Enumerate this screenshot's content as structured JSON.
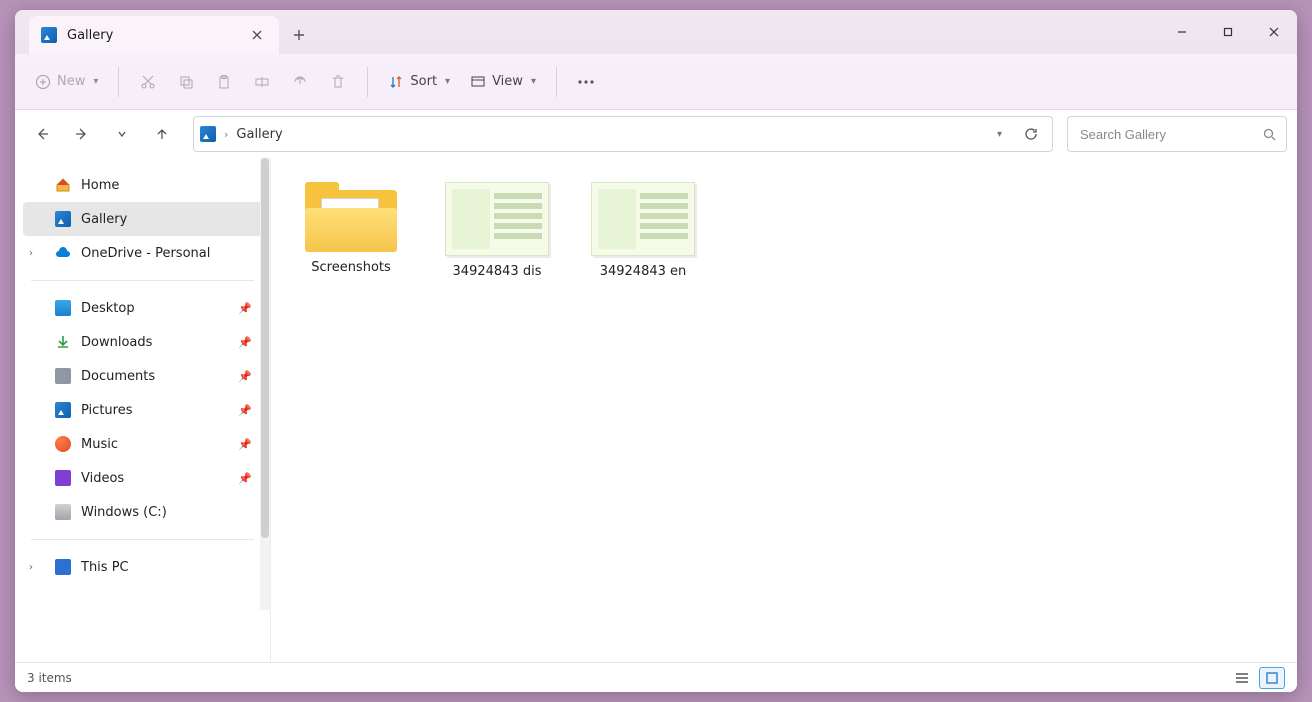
{
  "titlebar": {
    "tab_title": "Gallery"
  },
  "toolbar": {
    "new_label": "New",
    "sort_label": "Sort",
    "view_label": "View"
  },
  "breadcrumb": {
    "current": "Gallery"
  },
  "search": {
    "placeholder": "Search Gallery"
  },
  "sidebar": {
    "home": "Home",
    "gallery": "Gallery",
    "onedrive": "OneDrive - Personal",
    "desktop": "Desktop",
    "downloads": "Downloads",
    "documents": "Documents",
    "pictures": "Pictures",
    "music": "Music",
    "videos": "Videos",
    "drive_c": "Windows (C:)",
    "this_pc": "This PC"
  },
  "items": [
    {
      "type": "folder",
      "label": "Screenshots"
    },
    {
      "type": "image",
      "label": "34924843 dis"
    },
    {
      "type": "image",
      "label": "34924843 en"
    }
  ],
  "statusbar": {
    "count_text": "3 items"
  }
}
